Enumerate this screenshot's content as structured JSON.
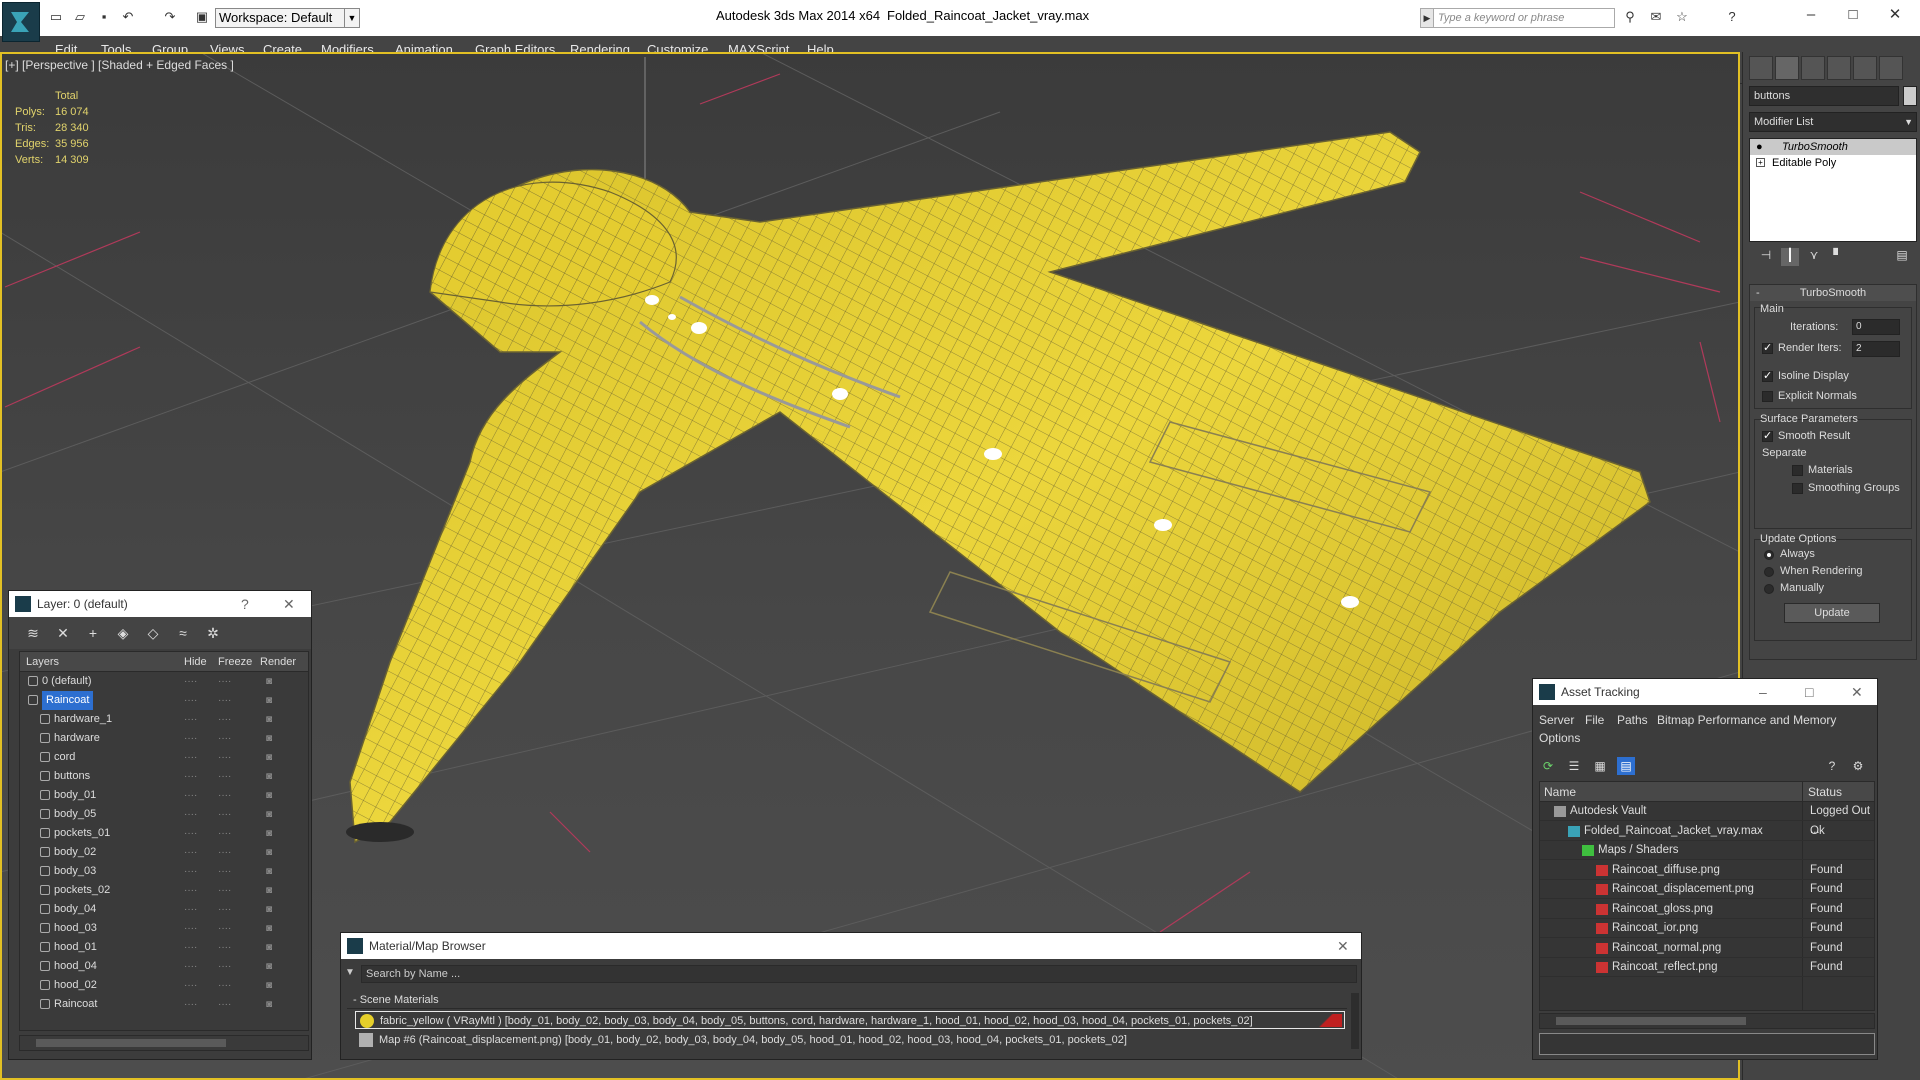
{
  "app": {
    "title": "Autodesk 3ds Max  2014 x64",
    "file": "Folded_Raincoat_Jacket_vray.max",
    "workspace": "Workspace: Default",
    "search_placeholder": "Type a keyword or phrase"
  },
  "menu": [
    "Edit",
    "Tools",
    "Group",
    "Views",
    "Create",
    "Modifiers",
    "Animation",
    "Graph Editors",
    "Rendering",
    "Customize",
    "MAXScript",
    "Help"
  ],
  "viewport": {
    "label": "[+] [Perspective ] [Shaded + Edged Faces ]",
    "stats_header": "Total",
    "stats": [
      {
        "label": "Polys:",
        "value": "16 074"
      },
      {
        "label": "Tris:",
        "value": "28 340"
      },
      {
        "label": "Edges:",
        "value": "35 956"
      },
      {
        "label": "Verts:",
        "value": "14 309"
      }
    ]
  },
  "command_panel": {
    "object_name": "buttons",
    "modifier_list": "Modifier List",
    "stack": [
      "TurboSmooth",
      "Editable Poly"
    ],
    "rollout_title": "TurboSmooth",
    "main_label": "Main",
    "iterations_label": "Iterations:",
    "iterations_value": "0",
    "render_iters_label": "Render Iters:",
    "render_iters_value": "2",
    "isoline": "Isoline Display",
    "explicit_normals": "Explicit Normals",
    "surface_params": "Surface Parameters",
    "smooth_result": "Smooth Result",
    "separate": "Separate",
    "materials": "Materials",
    "smoothing_groups": "Smoothing Groups",
    "update_options": "Update Options",
    "always": "Always",
    "when_rendering": "When Rendering",
    "manually": "Manually",
    "update_button": "Update"
  },
  "layers_panel": {
    "title": "Layer: 0 (default)",
    "help": "?",
    "columns": [
      "Layers",
      "Hide",
      "Freeze",
      "Render"
    ],
    "rows": [
      "0 (default)",
      "Raincoat",
      "hardware_1",
      "hardware",
      "cord",
      "buttons",
      "body_01",
      "body_05",
      "pockets_01",
      "body_02",
      "body_03",
      "pockets_02",
      "body_04",
      "hood_03",
      "hood_01",
      "hood_04",
      "hood_02",
      "Raincoat"
    ]
  },
  "material_browser": {
    "title": "Material/Map Browser",
    "search_placeholder": "Search by Name ...",
    "group": "- Scene Materials",
    "items": [
      "fabric_yellow  ( VRayMtl ) [body_01, body_02, body_03, body_04, body_05, buttons, cord, hardware, hardware_1, hood_01, hood_02, hood_03, hood_04, pockets_01, pockets_02]",
      "Map #6 (Raincoat_displacement.png)  [body_01, body_02, body_03, body_04, body_05, hood_01, hood_02, hood_03, hood_04, pockets_01, pockets_02]"
    ],
    "colors": {
      "fabric": "#e6cf2a",
      "map": "#b0b0b0"
    }
  },
  "asset_tracking": {
    "title": "Asset Tracking",
    "menu": [
      "Server",
      "File",
      "Paths",
      "Bitmap Performance and Memory",
      "Options"
    ],
    "columns": [
      "Name",
      "Status"
    ],
    "rows": [
      {
        "name": "Autodesk Vault",
        "status": "Logged Out ..."
      },
      {
        "name": "Folded_Raincoat_Jacket_vray.max",
        "status": "Ok"
      },
      {
        "name": "Maps / Shaders",
        "status": ""
      },
      {
        "name": "Raincoat_diffuse.png",
        "status": "Found"
      },
      {
        "name": "Raincoat_displacement.png",
        "status": "Found"
      },
      {
        "name": "Raincoat_gloss.png",
        "status": "Found"
      },
      {
        "name": "Raincoat_ior.png",
        "status": "Found"
      },
      {
        "name": "Raincoat_normal.png",
        "status": "Found"
      },
      {
        "name": "Raincoat_reflect.png",
        "status": "Found"
      }
    ]
  },
  "colors": {
    "viewport_border": "#e2c024",
    "stats_text": "#e1d36c",
    "raincoat": "#e8d238",
    "selection": "#2d6fd0"
  }
}
